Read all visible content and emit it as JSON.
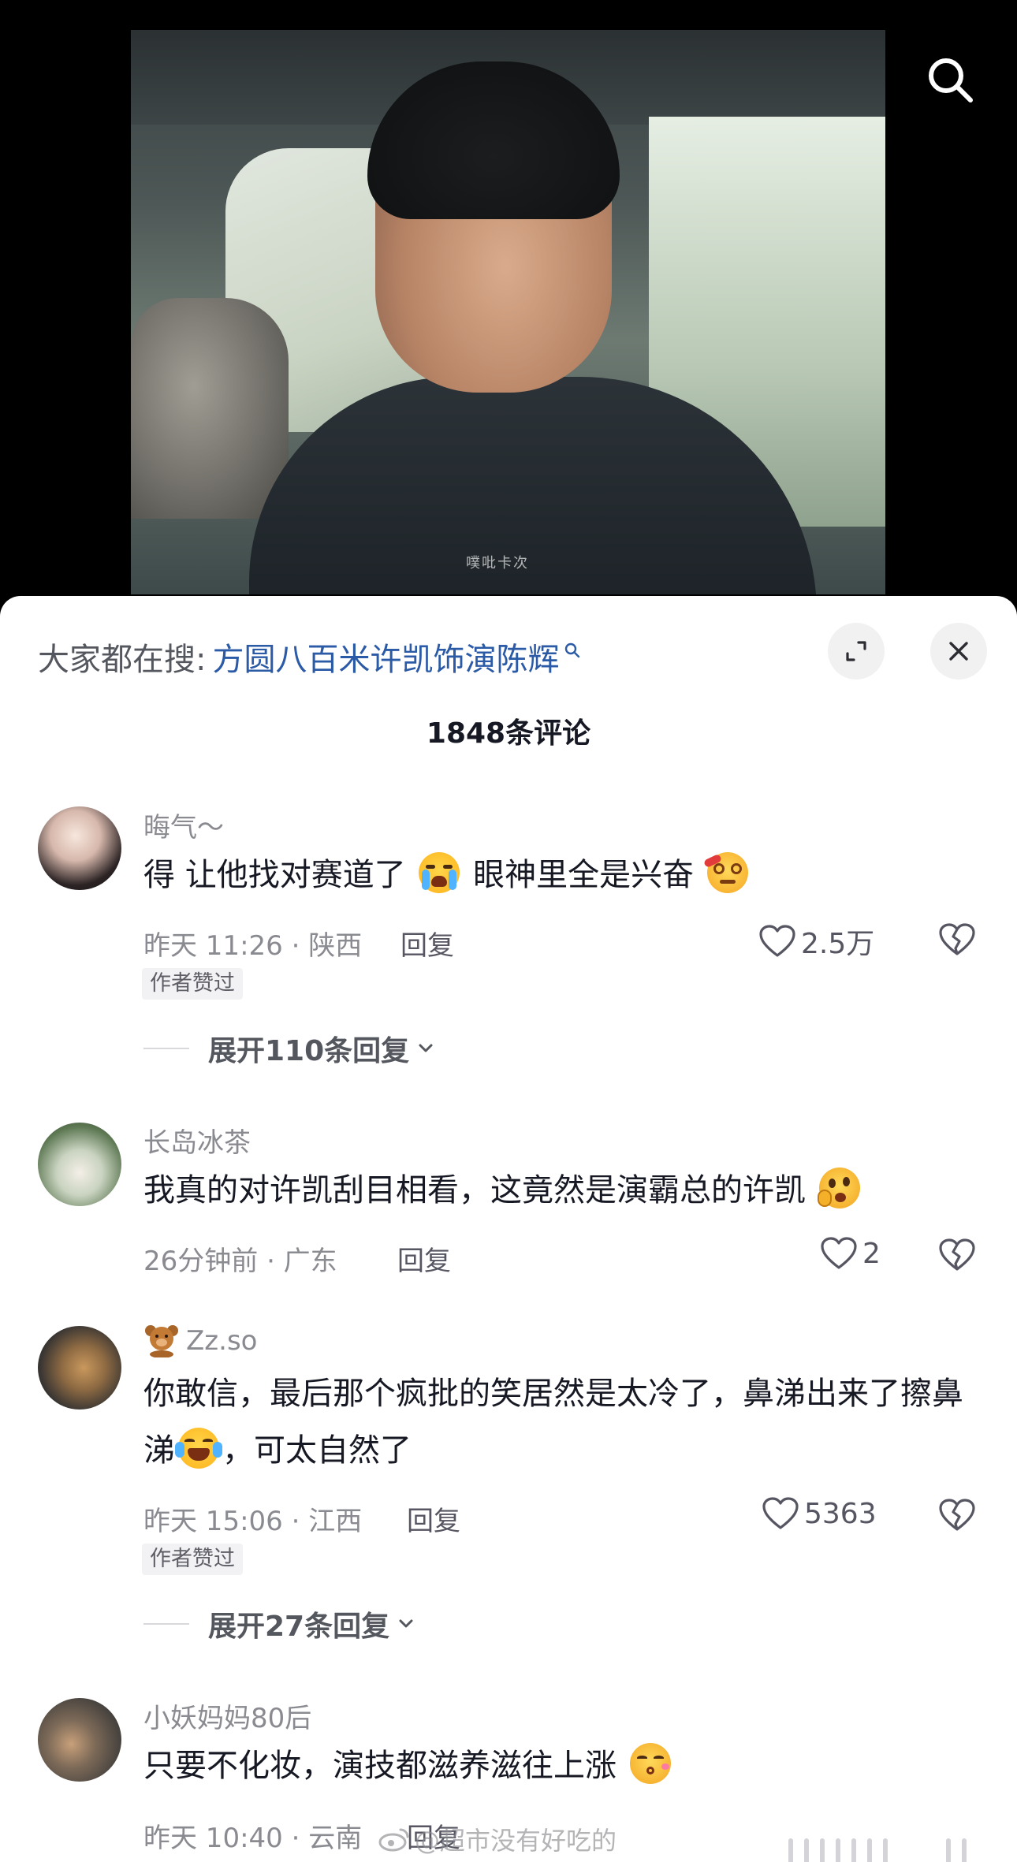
{
  "video": {
    "watermark": "噗吡卡次"
  },
  "panel": {
    "hot_search_prefix": "大家都在搜:",
    "hot_search_term": "方圆八百米许凯饰演陈辉",
    "comment_count": "1848条评论"
  },
  "comments": [
    {
      "username": "晦气～",
      "text_a": "得 让他找对赛道了",
      "emoji_a": "loudly-crying-face",
      "text_b": "眼神里全是兴奋",
      "emoji_b": "woozy-face",
      "time": "昨天 11:26 · 陕西",
      "reply": "回复",
      "likes": "2.5万",
      "badge": "作者赞过",
      "expand": "展开110条回复"
    },
    {
      "username": "长岛冰茶",
      "text_a": "我真的对许凯刮目相看，这竟然是演霸总的许凯",
      "emoji_a": "thinking-face",
      "time": "26分钟前 · 广东",
      "reply": "回复",
      "likes": "2"
    },
    {
      "username_icon": "teddy-bear",
      "username": "Zz.so",
      "text_a": "你敢信，最后那个疯批的笑居然是太冷了，鼻涕出来了擦鼻涕",
      "emoji_a": "face-with-tears-of-joy",
      "text_b": "，可太自然了",
      "time": "昨天 15:06 · 江西",
      "reply": "回复",
      "likes": "5363",
      "badge": "作者赞过",
      "expand": "展开27条回复"
    },
    {
      "username": "小妖妈妈80后",
      "text_a": "只要不化妆，演技都滋养滋往上涨",
      "emoji_a": "kissing-face",
      "time": "昨天 10:40 · 云南",
      "reply": "回复"
    }
  ],
  "footer": {
    "watermark": "@超市没有好吃的"
  },
  "colors": {
    "link_blue": "#2b5aa6",
    "meta_grey": "#8a8b91",
    "text_dark": "#161823"
  }
}
